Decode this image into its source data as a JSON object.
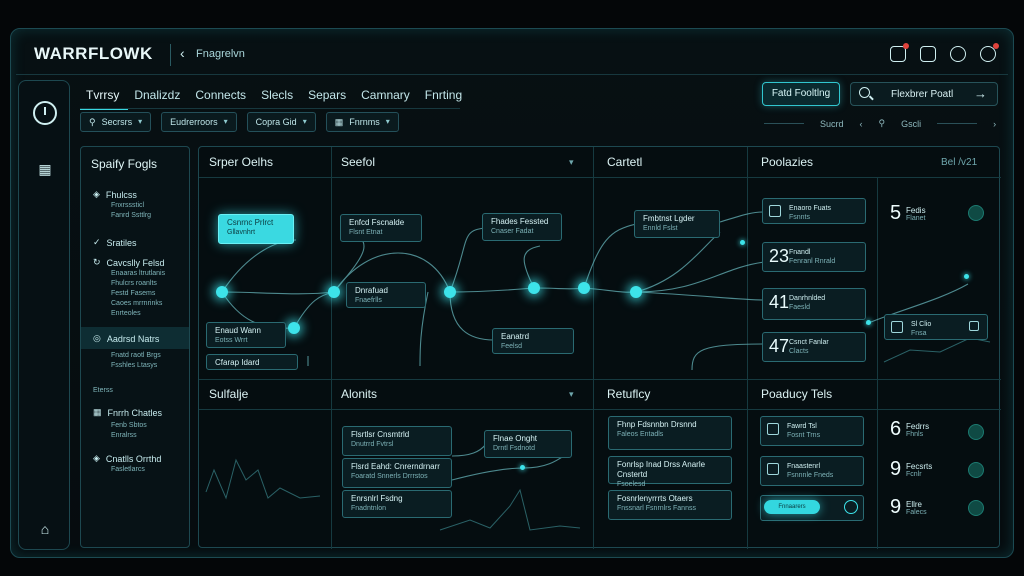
{
  "header": {
    "brand": "WARRFLOWK",
    "crumb": "Fnagrelvn",
    "icons": [
      "notification-icon",
      "clipboard-icon",
      "bell-icon",
      "profile-icon"
    ]
  },
  "tabs": [
    {
      "label": "Tvrrsy",
      "active": true
    },
    {
      "label": "Dnalizdz",
      "active": false
    },
    {
      "label": "Connects",
      "active": false
    },
    {
      "label": "Slecls",
      "active": false
    },
    {
      "label": "Separs",
      "active": false
    },
    {
      "label": "Camnary",
      "active": false
    },
    {
      "label": "Fnrting",
      "active": false
    }
  ],
  "cta_label": "Fatd Fooltlng",
  "search": {
    "value": "Flexbrer Poatl"
  },
  "filters": [
    {
      "label": "Secrsrs"
    },
    {
      "label": "Eudrerroors"
    },
    {
      "label": "Copra Gid"
    },
    {
      "label": "Fnrnms"
    }
  ],
  "pager": {
    "left": "Sucrd",
    "right": "Gscli"
  },
  "left_panel": {
    "title": "Spaify Fogls",
    "sections": [
      {
        "label": "Fhulcss",
        "subs": [
          "Fnxrsssticl",
          "Fanrd Ssttlrg"
        ]
      },
      {
        "label": "Sratiles",
        "subs": []
      },
      {
        "label": "Cavcslly Felsd",
        "subs": [
          "Enaaras ltrutlanis",
          "Fhulcrs roanlts",
          "Festd Fasems",
          "Caoes mrrnrinks",
          "Enrteoles"
        ]
      },
      {
        "label": "Aadrsd Natrs",
        "subs": [
          "Fnatd raotl Brgs",
          "Fsshles Ltasys"
        ]
      },
      {
        "label": "Eterss",
        "subs": []
      },
      {
        "label": "Fnrrh Chatles",
        "subs": [
          "Fenb Sbtos",
          "Enralrss"
        ]
      },
      {
        "label": "Cnatlls Orrthd",
        "subs": [
          "Fasletlarcs"
        ]
      }
    ]
  },
  "columns_top": [
    "Srper Oelhs",
    "Seefol",
    "Cartetl",
    "Poolazies"
  ],
  "columns_bottom": [
    "Sulfalje",
    "Alonits",
    "Retuflcy",
    "Poaducy Tels"
  ],
  "date_label": "Bel /v21",
  "nodes": [
    {
      "t": "Csnrnc Prlrct",
      "s": "Gllavnhrt"
    },
    {
      "t": "Enfcd Fscnalde",
      "s": "Flsnt Etnat"
    },
    {
      "t": "Fhades Fessted",
      "s": "Cnaser Fadat"
    },
    {
      "t": "Fmbtnst Lgder",
      "s": "Ennld Fslst"
    },
    {
      "t": "Dnrafuad",
      "s": "Fnaefrlls"
    },
    {
      "t": "Eanatrd",
      "s": "Feelsd"
    },
    {
      "t": "Enaud Wann",
      "s": "Eotss Wrrt"
    },
    {
      "t": "Cfarap Idard",
      "s": ""
    }
  ],
  "stats_top": [
    {
      "num": "",
      "t": "Enaoro Fuats",
      "s": "Fsnnts"
    },
    {
      "num": "23",
      "t": "Fnandl",
      "s": "Fenranl Rnrald"
    },
    {
      "num": "41",
      "t": "Danrhnlded",
      "s": "Faesld"
    },
    {
      "num": "47",
      "t": "Csnct Fanlar",
      "s": "Clacts"
    }
  ],
  "kpis_top": [
    {
      "num": "5",
      "t": "Fedis",
      "s": "Flanet"
    },
    {
      "num": "",
      "t": "Sl Clio",
      "s": "Fnsa"
    }
  ],
  "alerts_nodes": [
    {
      "t": "Flsrtlsr Cnsmtrld",
      "s": "Dnutrrd Fvtrsl"
    },
    {
      "t": "Flsrd Eahd: Cnrerndrnarr",
      "s": "Foaratd Snnerls Drrrstos"
    },
    {
      "t": "Enrsnlrl Fsdng",
      "s": "Fnadntnlon"
    },
    {
      "t": "Flnae Onght",
      "s": "Drntl Fsdnotd"
    }
  ],
  "returns": [
    {
      "t": "Fhnp Fdsnnbn Drsnnd",
      "s": "Faleos Entadls"
    },
    {
      "t": "Fonrlsp Inad Drss Anarle Cnstertd",
      "s": "Fsoelesd"
    },
    {
      "t": "Fosnrlenyrrrts Otaers",
      "s": "Fnssnarl Fsnrnlrs Fannss"
    }
  ],
  "product_stats": [
    {
      "t": "Fawrd Tsl",
      "s": "Fosnt Trns"
    },
    {
      "t": "Fnaastenrl",
      "s": "Fsnnnle Fneds"
    }
  ],
  "pill_label": "Fnnaarers",
  "kpis_bottom": [
    {
      "num": "6",
      "t": "Fedrrs",
      "s": "Fhnls"
    },
    {
      "num": "9",
      "t": "Fecsrts",
      "s": "Fcnlr"
    },
    {
      "num": "9",
      "t": "Ellre",
      "s": "Falecs"
    }
  ]
}
